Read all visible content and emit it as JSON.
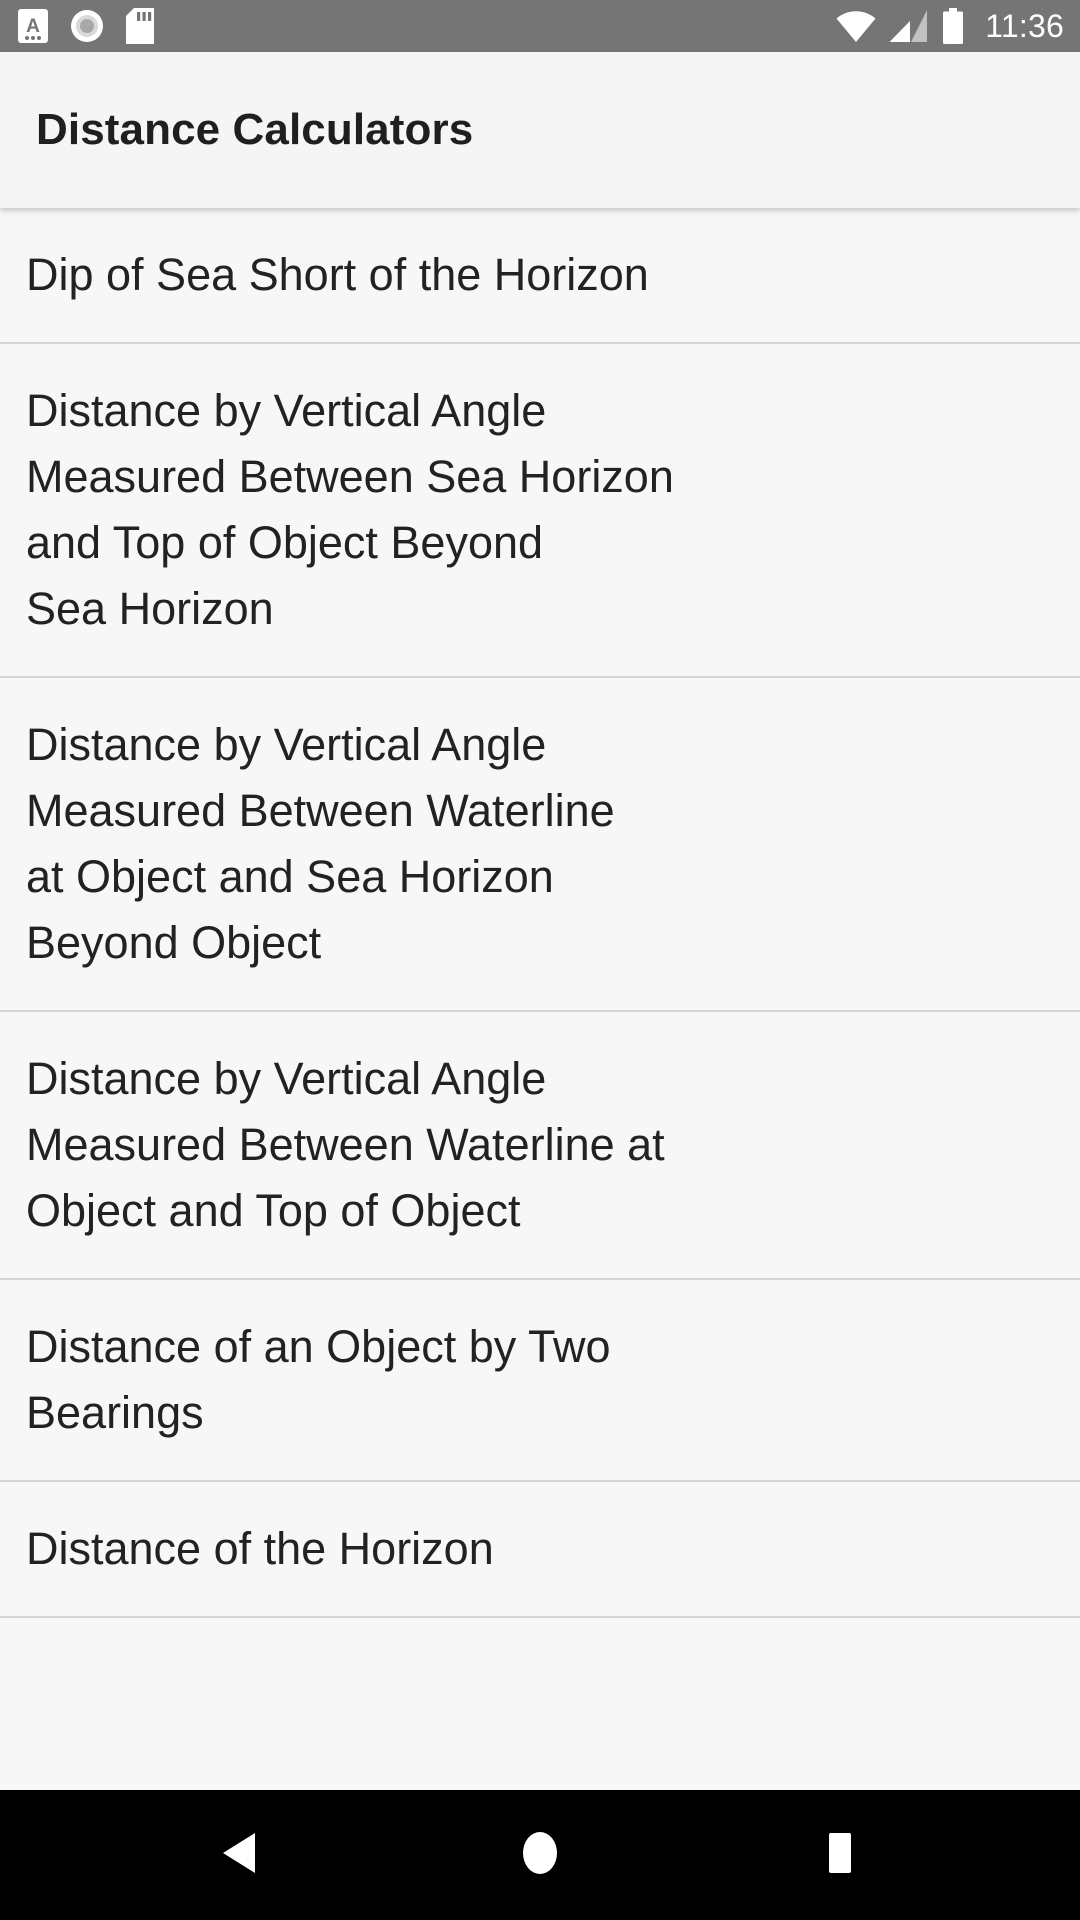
{
  "status_bar": {
    "background_color": "#757575",
    "left_icons": [
      {
        "name": "text-input-a-icon",
        "glyph": "A"
      },
      {
        "name": "record-circle-icon"
      },
      {
        "name": "sd-card-icon"
      }
    ],
    "right_icons": [
      {
        "name": "wifi-icon"
      },
      {
        "name": "cellular-signal-icon"
      },
      {
        "name": "battery-full-icon"
      }
    ],
    "time": "11:36"
  },
  "app_bar": {
    "title": "Distance Calculators",
    "background_color": "#f5f5f5",
    "text_color": "#1f1f1f"
  },
  "list": {
    "background_color": "#f7f7f7",
    "divider_color": "#d4d4d4",
    "items": [
      {
        "label": "Dip of Sea Short of the Horizon"
      },
      {
        "label": "Distance by Vertical Angle\nMeasured Between Sea Horizon\nand Top of Object Beyond\nSea Horizon"
      },
      {
        "label": "Distance by Vertical Angle\nMeasured Between Waterline\nat Object and Sea Horizon\nBeyond Object"
      },
      {
        "label": "Distance by Vertical Angle\nMeasured Between Waterline at\nObject and Top of Object"
      },
      {
        "label": "Distance of an Object by Two\nBearings"
      },
      {
        "label": "Distance of the Horizon"
      }
    ]
  },
  "nav_bar": {
    "background_color": "#000000",
    "buttons": [
      {
        "name": "back-button",
        "icon": "back-triangle-icon"
      },
      {
        "name": "home-button",
        "icon": "home-circle-icon"
      },
      {
        "name": "recents-button",
        "icon": "recents-square-icon"
      }
    ]
  }
}
